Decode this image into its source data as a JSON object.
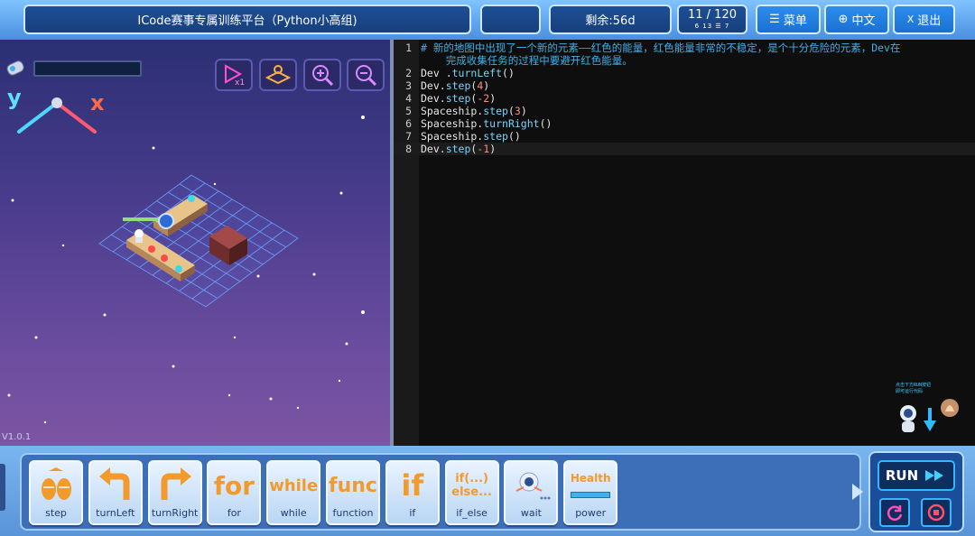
{
  "header": {
    "title": "ICode赛事专属训练平台（Python小高组)",
    "blank": "",
    "remaining": "剩余:56d",
    "progress": "11 / 120",
    "progress_sub1": "6 13",
    "progress_sub2": "☰ 7",
    "menu_label": "菜单",
    "lang_label": "中文",
    "exit_label": "退出"
  },
  "scene": {
    "axis_x": "x",
    "axis_y": "y",
    "version": "V1.0.1"
  },
  "editor": {
    "lines": [
      {
        "n": "1",
        "comment": "# 新的地图中出现了一个新的元素——红色的能量，红色能量非常的不稳定，是个十分危险的元素，Dev在"
      },
      {
        "n": "",
        "comment": "    完成收集任务的过程中要避开红色能量。"
      },
      {
        "n": "2",
        "obj": "Dev .",
        "fn": "turnLeft",
        "arg": "",
        "tail": "()"
      },
      {
        "n": "3",
        "obj": "Dev.",
        "fn": "step",
        "arg": "4"
      },
      {
        "n": "4",
        "obj": "Dev.",
        "fn": "step",
        "arg": "-2"
      },
      {
        "n": "5",
        "obj": "Spaceship.",
        "fn": "step",
        "arg": "3"
      },
      {
        "n": "6",
        "obj": "Spaceship.",
        "fn": "turnRight",
        "arg": "",
        "tail": "()"
      },
      {
        "n": "7",
        "obj": "Spaceship.",
        "fn": "step",
        "arg": "",
        "tail": "()"
      },
      {
        "n": "8",
        "obj": "Dev.",
        "fn": "step",
        "arg": "-1"
      }
    ],
    "robot_tip_line1": "点击下方RUN按钮",
    "robot_tip_line2": "即可运行代码"
  },
  "blocks": [
    {
      "label": "step",
      "glyph": "",
      "icon": "feet-icon"
    },
    {
      "label": "turnLeft",
      "glyph": "",
      "icon": "turn-left-arrow-icon"
    },
    {
      "label": "turnRight",
      "glyph": "",
      "icon": "turn-right-arrow-icon"
    },
    {
      "label": "for",
      "glyph": "for"
    },
    {
      "label": "while",
      "glyph": "while"
    },
    {
      "label": "function",
      "glyph": "func"
    },
    {
      "label": "if",
      "glyph": "if"
    },
    {
      "label": "if_else",
      "glyph": "if(...)",
      "glyph2": "else..."
    },
    {
      "label": "wait",
      "glyph": "",
      "icon": "robot-icon"
    },
    {
      "label": "power",
      "glyph": "Health",
      "icon": "health-bar-icon"
    }
  ],
  "run": {
    "label": "RUN"
  },
  "colors": {
    "accent": "#39b4ff",
    "orange": "#f39a2c",
    "comment": "#3fb0e8"
  }
}
